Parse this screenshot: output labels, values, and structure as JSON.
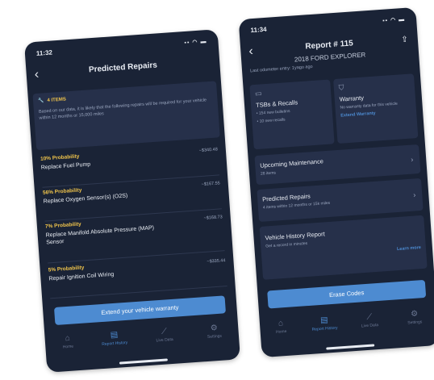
{
  "left": {
    "time": "11:32",
    "title": "Predicted Repairs",
    "notice_label": "4 ITEMS",
    "notice_body": "Based on our data, it is likely that the following repairs will be required for your vehicle within 12 months or 15,000 miles",
    "repairs": [
      {
        "probability": "10% Probability",
        "name": "Replace Fuel Pump",
        "price": "~$340.48"
      },
      {
        "probability": "56% Probability",
        "name": "Replace Oxygen Sensor(s) (O2S)",
        "price": "~$167.55"
      },
      {
        "probability": "7% Probability",
        "name": "Replace Manifold Absolute Pressure (MAP) Sensor",
        "price": "~$168.73"
      },
      {
        "probability": "5% Probability",
        "name": "Repair Ignition Coil Wiring",
        "price": "~$335.44"
      }
    ],
    "cta": "Extend your vehicle warranty",
    "tabs": [
      "Home",
      "Report History",
      "Live Data",
      "Settings"
    ],
    "active_tab": 1
  },
  "right": {
    "time": "11:34",
    "title": "Report # 115",
    "vehicle": "2018 FORD EXPLORER",
    "odometer": "Last odometer entry: 1yago ago",
    "tsb": {
      "title": "TSBs & Recalls",
      "line1": "• 154 new bulletins",
      "line2": "• 10 new recalls"
    },
    "warranty": {
      "title": "Warranty",
      "desc": "No warranty data for this vehicle",
      "link": "Extend Warranty"
    },
    "maintenance": {
      "title": "Upcoming Maintenance",
      "sub": "28 items"
    },
    "predicted": {
      "title": "Predicted Repairs",
      "sub": "4 items within 12 months or 15k miles"
    },
    "history": {
      "title": "Vehicle History Report",
      "sub": "Get a record in minutes",
      "link": "Learn more"
    },
    "erase": "Erase Codes",
    "tabs": [
      "Home",
      "Report History",
      "Live Data",
      "Settings"
    ],
    "active_tab": 1
  }
}
